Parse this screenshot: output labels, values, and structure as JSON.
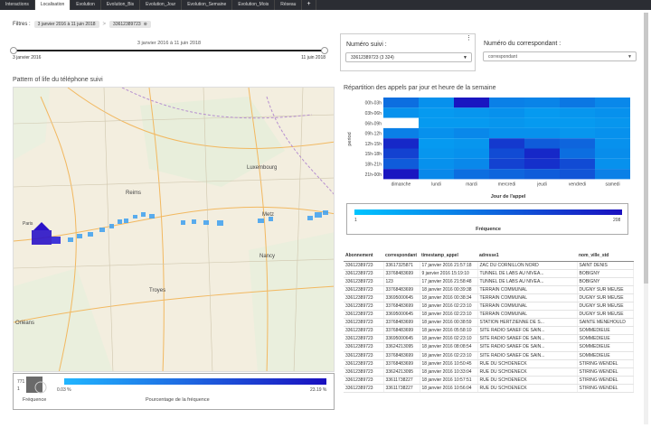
{
  "tabs": [
    {
      "label": "Interactions",
      "active": false
    },
    {
      "label": "Localisation",
      "active": true
    },
    {
      "label": "Evolution",
      "active": false
    },
    {
      "label": "Evolution_Bis",
      "active": false
    },
    {
      "label": "Evolution_Jour",
      "active": false
    },
    {
      "label": "Evolution_Semaine",
      "active": false
    },
    {
      "label": "Evolution_Mois",
      "active": false
    },
    {
      "label": "Réseau",
      "active": false
    }
  ],
  "add_tab": "+",
  "filters": {
    "label": "Filtres :",
    "date_chip": "3 janvier 2016 à 11 juin 2018",
    "separator": ">",
    "number_chip": "33612389723"
  },
  "date_slider": {
    "range_label": "3 janvier 2016 à 11 juin 2018",
    "start": "3 janvier 2016",
    "end": "11 juin 2018"
  },
  "numero_suivi": {
    "label": "Numéro suivi :",
    "value": "33612389723 (3 324)"
  },
  "correspondant": {
    "label": "Numéro du correspondant :",
    "placeholder": "correspondant"
  },
  "more_icon": "⋮",
  "map": {
    "title": "Pattern of life du téléphone suivi",
    "labels": {
      "luxembourg": "Luxembourg",
      "reims": "Reims",
      "metz": "Metz",
      "nancy": "Nancy",
      "troyes": "Troyes",
      "orleans": "Orléans",
      "paris": "Paris"
    },
    "legend": {
      "count": "771",
      "count_min": "1",
      "freq_label": "Fréquence",
      "pct_min": "0.03 %",
      "pct_max": "23.19 %",
      "pct_label": "Pourcentage de la fréquence"
    }
  },
  "heatmap": {
    "title": "Répartition des appels par jour et heure de la semaine",
    "ylabel": "period",
    "xlabel": "Jour de l'appel",
    "legend_min": "1",
    "legend_max": "208",
    "legend_label": "Fréquence"
  },
  "chart_data": {
    "type": "heatmap",
    "title": "Répartition des appels par jour et heure de la semaine",
    "xlabel": "Jour de l'appel",
    "ylabel": "period",
    "x": [
      "dimanche",
      "lundi",
      "mardi",
      "mercredi",
      "jeudi",
      "vendredi",
      "samedi"
    ],
    "y": [
      "00h-03h",
      "03h-06h",
      "06h-09h",
      "09h-12h",
      "12h-15h",
      "15h-18h",
      "18h-21h",
      "21h-00h"
    ],
    "values": [
      [
        100,
        60,
        200,
        80,
        75,
        90,
        70
      ],
      [
        60,
        50,
        55,
        60,
        50,
        55,
        60
      ],
      [
        1,
        50,
        50,
        55,
        50,
        50,
        55
      ],
      [
        80,
        60,
        70,
        60,
        60,
        55,
        60
      ],
      [
        180,
        50,
        55,
        160,
        120,
        110,
        60
      ],
      [
        150,
        55,
        60,
        140,
        180,
        100,
        65
      ],
      [
        120,
        60,
        70,
        150,
        170,
        140,
        60
      ],
      [
        200,
        70,
        100,
        110,
        120,
        130,
        80
      ]
    ],
    "color_range": [
      1,
      208
    ]
  },
  "table": {
    "columns": [
      "Abonnement",
      "correspondant",
      "timestamp_appel",
      "adresse1",
      "nom_ville_std"
    ],
    "rows": [
      [
        "33612389723",
        "33617325871",
        "17 janvier 2016 21:57:18",
        "ZAC DU CORNILLON NORD",
        "SAINT DENIS"
      ],
      [
        "33612389723",
        "33768483699",
        "9 janvier 2016 15:19:10",
        "TUNNEL DE LABS AU NIVEA...",
        "BOBIGNY"
      ],
      [
        "33612389723",
        "123",
        "17 janvier 2016 21:58:48",
        "TUNNEL DE LABS AU NIVEA...",
        "BOBIGNY"
      ],
      [
        "33612389723",
        "33768483699",
        "18 janvier 2016 00:39:38",
        "TERRAIN COMMUNAL",
        "DUGNY SUR MEUSE"
      ],
      [
        "33612389723",
        "33695000645",
        "18 janvier 2016 00:38:34",
        "TERRAIN COMMUNAL",
        "DUGNY SUR MEUSE"
      ],
      [
        "33612389723",
        "33768483699",
        "18 janvier 2016 02:23:10",
        "TERRAIN COMMUNAL",
        "DUGNY SUR MEUSE"
      ],
      [
        "33612389723",
        "33695000645",
        "18 janvier 2016 02:23:10",
        "TERRAIN COMMUNAL",
        "DUGNY SUR MEUSE"
      ],
      [
        "33612389723",
        "33768483699",
        "18 janvier 2016 00:38:59",
        "STATION HERTZIENNE DE S...",
        "SAINTE MENEHOULD"
      ],
      [
        "33612389723",
        "33768483699",
        "18 janvier 2016 05:58:10",
        "SITE RADIO SANEF DE SAIN...",
        "SOMMEDIEUE"
      ],
      [
        "33612389723",
        "33695000645",
        "18 janvier 2016 02:23:10",
        "SITE RADIO SANEF DE SAIN...",
        "SOMMEDIEUE"
      ],
      [
        "33612389723",
        "33624213095",
        "18 janvier 2016 08:08:54",
        "SITE RADIO SANEF DE SAIN...",
        "SOMMEDIEUE"
      ],
      [
        "33612389723",
        "33768483699",
        "18 janvier 2016 02:23:10",
        "SITE RADIO SANEF DE SAIN...",
        "SOMMEDIEUE"
      ],
      [
        "33612389723",
        "33768483699",
        "18 janvier 2016 10:50:45",
        "RUE DU SCHOENECK",
        "STIRING WENDEL"
      ],
      [
        "33612389723",
        "33624213095",
        "18 janvier 2016 10:33:04",
        "RUE DU SCHOENECK",
        "STIRING WENDEL"
      ],
      [
        "33612389723",
        "33611738227",
        "18 janvier 2016 10:57:51",
        "RUE DU SCHOENECK",
        "STIRING WENDEL"
      ],
      [
        "33612389723",
        "33611738227",
        "18 janvier 2016 10:56:04",
        "RUE DU SCHOENECK",
        "STIRING WENDEL"
      ]
    ]
  },
  "colors": {
    "tab_bar": "#2b2d33",
    "accent": "#1a10c8",
    "heat_low": "#0aa8ff",
    "heat_high": "#1a0fbf"
  }
}
